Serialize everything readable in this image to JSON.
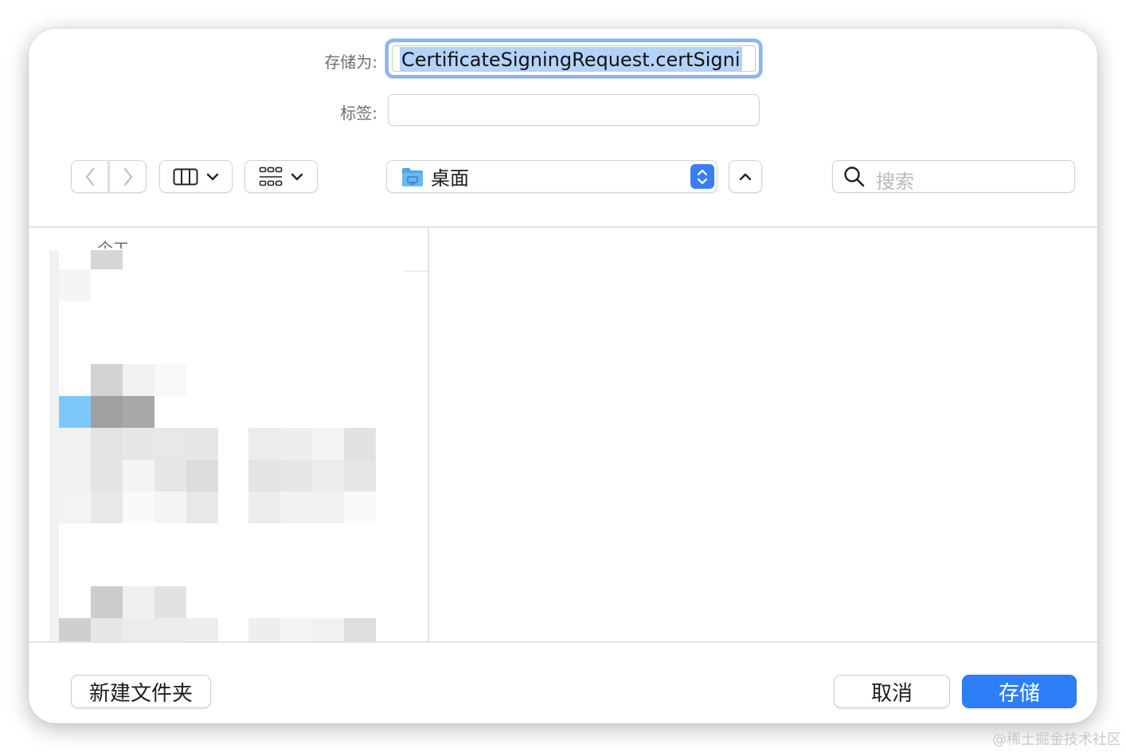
{
  "dialog": {
    "save_as_label": "存储为:",
    "file_name": "CertificateSigningRequest.certSigni",
    "tags_label": "标签:",
    "tags_value": ""
  },
  "toolbar": {
    "location": "桌面",
    "search_placeholder": "搜索",
    "accent_color": "#3b7ef2"
  },
  "sidebar": {
    "title_partial": "个工"
  },
  "footer": {
    "new_folder_label": "新建文件夹",
    "cancel_label": "取消",
    "save_label": "存储",
    "save_color": "#2c7ff6"
  },
  "watermark": "@稀土掘金技术社区"
}
